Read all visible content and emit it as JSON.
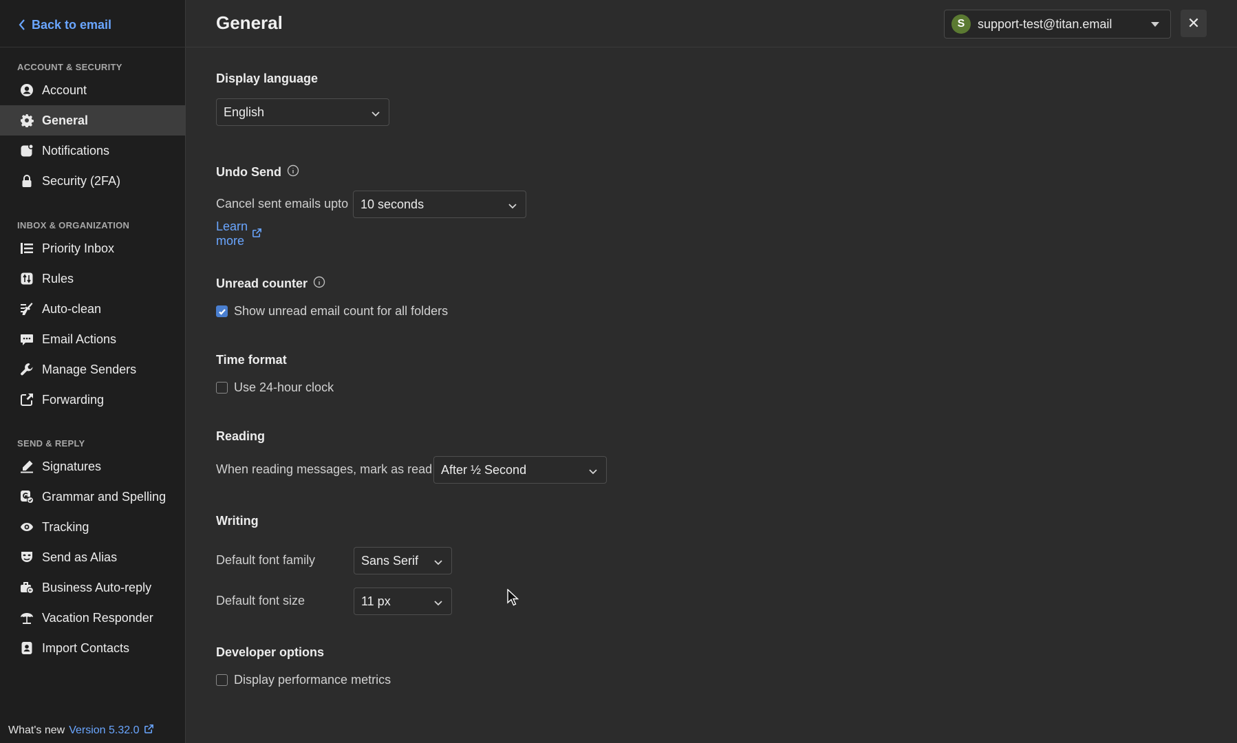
{
  "sidebar": {
    "back_label": "Back to email",
    "sections": [
      {
        "heading": "ACCOUNT & SECURITY",
        "items": [
          {
            "label": "Account",
            "icon": "account-icon"
          },
          {
            "label": "General",
            "icon": "gear-icon",
            "active": true
          },
          {
            "label": "Notifications",
            "icon": "notification-icon"
          },
          {
            "label": "Security (2FA)",
            "icon": "lock-icon"
          }
        ]
      },
      {
        "heading": "INBOX & ORGANIZATION",
        "items": [
          {
            "label": "Priority Inbox",
            "icon": "priority-list-icon"
          },
          {
            "label": "Rules",
            "icon": "rules-icon"
          },
          {
            "label": "Auto-clean",
            "icon": "broom-icon"
          },
          {
            "label": "Email Actions",
            "icon": "email-actions-icon"
          },
          {
            "label": "Manage Senders",
            "icon": "wrench-icon"
          },
          {
            "label": "Forwarding",
            "icon": "forward-icon"
          }
        ]
      },
      {
        "heading": "SEND & REPLY",
        "items": [
          {
            "label": "Signatures",
            "icon": "pen-icon"
          },
          {
            "label": "Grammar and Spelling",
            "icon": "grammar-icon"
          },
          {
            "label": "Tracking",
            "icon": "eye-icon"
          },
          {
            "label": "Send as Alias",
            "icon": "mask-icon"
          },
          {
            "label": "Business Auto-reply",
            "icon": "briefcase-reply-icon"
          },
          {
            "label": "Vacation Responder",
            "icon": "umbrella-icon"
          },
          {
            "label": "Import Contacts",
            "icon": "contacts-icon"
          }
        ]
      }
    ],
    "whats_new_label": "What's new",
    "version_label": "Version 5.32.0"
  },
  "header": {
    "title": "General",
    "account_initial": "S",
    "account_email": "support-test@titan.email",
    "close_label": "✕"
  },
  "settings": {
    "display_language": {
      "title": "Display language",
      "value": "English"
    },
    "undo_send": {
      "title": "Undo Send",
      "label": "Cancel sent emails upto",
      "value": "10 seconds",
      "learn_more": "Learn more"
    },
    "unread_counter": {
      "title": "Unread counter",
      "checkbox_label": "Show unread email count for all folders",
      "checked": true
    },
    "time_format": {
      "title": "Time format",
      "checkbox_label": "Use 24-hour clock",
      "checked": false
    },
    "reading": {
      "title": "Reading",
      "label": "When reading messages, mark as read",
      "value": "After ½ Second"
    },
    "writing": {
      "title": "Writing",
      "font_family_label": "Default font family",
      "font_family_value": "Sans Serif",
      "font_size_label": "Default font size",
      "font_size_value": "11 px"
    },
    "developer": {
      "title": "Developer options",
      "checkbox_label": "Display performance metrics",
      "checked": false
    }
  },
  "colors": {
    "accent": "#6aa6ff",
    "sidebar_bg": "#1e1e1e",
    "main_bg": "#2c2c2c",
    "active_item_bg": "#3d3d3d",
    "avatar_bg": "#5b7a32"
  }
}
